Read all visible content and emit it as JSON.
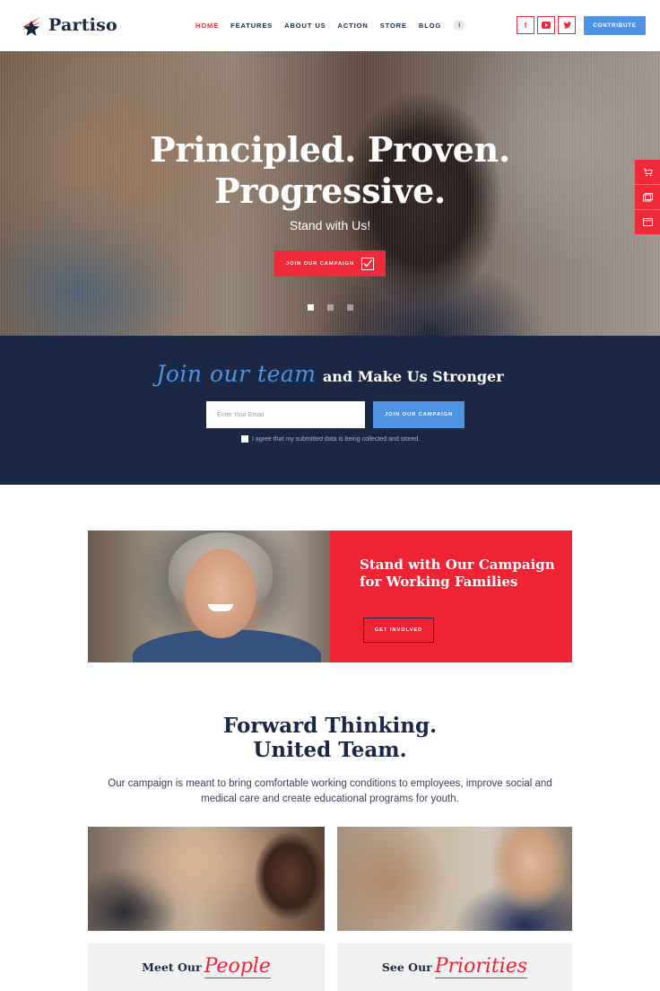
{
  "header": {
    "logo_text": "Partiso",
    "nav": [
      "HOME",
      "FEATURES",
      "ABOUT US",
      "ACTION",
      "STORE",
      "BLOG"
    ],
    "info_glyph": "i",
    "socials": [
      {
        "icon": "facebook-icon",
        "glyph": "f"
      },
      {
        "icon": "youtube-icon",
        "glyph": "▶"
      },
      {
        "icon": "twitter-icon",
        "glyph": "🐦"
      }
    ],
    "contribute_label": "CONTRIBUTE"
  },
  "hero": {
    "title_line1": "Principled. Proven.",
    "title_line2": "Progressive.",
    "subtitle": "Stand with Us!",
    "button_label": "JOIN OUR CAMPAIGN",
    "slides_total": 3,
    "active_slide": 1
  },
  "side_tools": [
    "cart-icon",
    "gallery-icon",
    "browser-icon"
  ],
  "join": {
    "script_text": "Join our team",
    "serif_text": "and Make Us Stronger",
    "email_placeholder": "Enter Your Email",
    "button_label": "JOIN OUR CAMPAIGN",
    "agree_text": "I agree that my submitted data is being collected and stored."
  },
  "campaign": {
    "title": "Stand with Our Campaign for Working Families",
    "button_label": "GET INVOLVED"
  },
  "forward": {
    "title_line1": "Forward Thinking.",
    "title_line2": "United Team.",
    "text": "Our campaign is meant to bring comfortable working conditions to employees, improve social and medical care and create educational programs for youth."
  },
  "tiles": [
    {
      "serif": "Meet Our",
      "script": "People"
    },
    {
      "serif": "See Our",
      "script": "Priorities"
    }
  ],
  "colors": {
    "accent_red": "#ef2a3a",
    "accent_blue": "#4f94e3",
    "navy": "#1b2844"
  }
}
